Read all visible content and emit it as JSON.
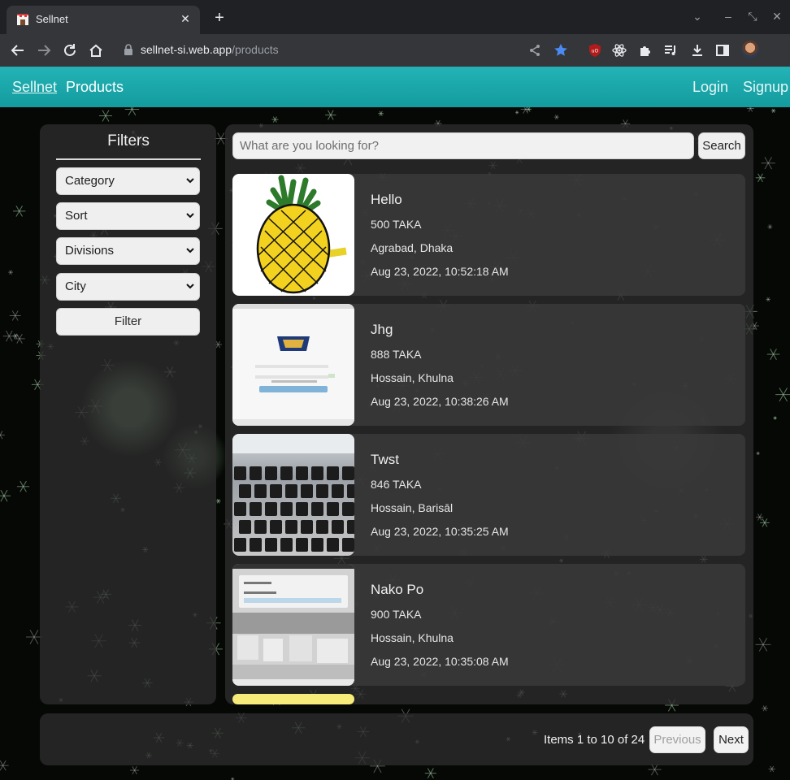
{
  "browser": {
    "tab_title": "Sellnet",
    "url_host": "sellnet-si.web.app",
    "url_path": "/products"
  },
  "navbar": {
    "brand": "Sellnet",
    "products": "Products",
    "login": "Login",
    "signup": "Signup"
  },
  "filters": {
    "title": "Filters",
    "category": "Category",
    "sort": "Sort",
    "divisions": "Divisions",
    "city": "City",
    "filter_button": "Filter"
  },
  "search": {
    "placeholder": "What are you looking for?",
    "button": "Search"
  },
  "products": [
    {
      "title": "Hello",
      "price": "500 TAKA",
      "location": "Agrabad, Dhaka",
      "date": "Aug 23, 2022, 10:52:18 AM",
      "image": "pineapple-drawing"
    },
    {
      "title": "Jhg",
      "price": "888 TAKA",
      "location": "Hossain, Khulna",
      "date": "Aug 23, 2022, 10:38:26 AM",
      "image": "app-login-screenshot"
    },
    {
      "title": "Twst",
      "price": "846 TAKA",
      "location": "Hossain, Barisāl",
      "date": "Aug 23, 2022, 10:35:25 AM",
      "image": "keyboard-photo"
    },
    {
      "title": "Nako Po",
      "price": "900 TAKA",
      "location": "Hossain, Khulna",
      "date": "Aug 23, 2022, 10:35:08 AM",
      "image": "warehouse-photo"
    }
  ],
  "pagination": {
    "info": "Items 1 to 10 of 24",
    "previous": "Previous",
    "next": "Next"
  },
  "colors": {
    "navbar": "#1aa5a8",
    "panel": "#2d2d2d",
    "background": "#050805"
  }
}
